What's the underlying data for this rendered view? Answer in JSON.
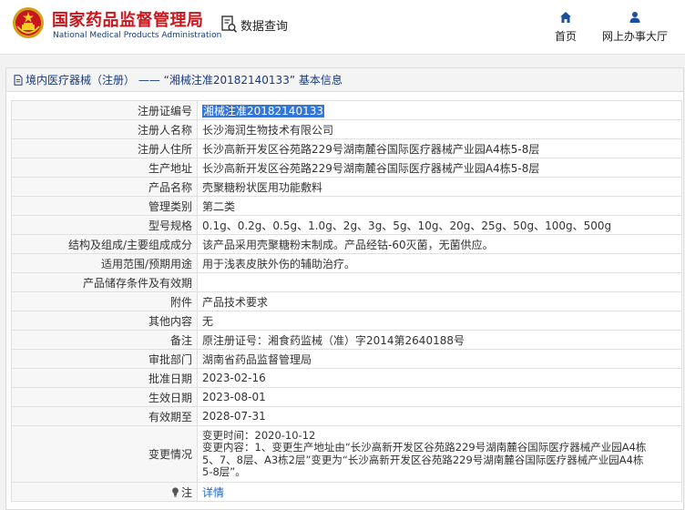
{
  "header": {
    "title": "国家药品监督管理局",
    "subtitle": "National Medical Products Administration",
    "search_label": "数据查询",
    "nav": {
      "home_label": "首页",
      "service_label": "网上办事大厅"
    }
  },
  "panel": {
    "title": "境内医疗器械（注册） —— “湘械注准20182140133” 基本信息"
  },
  "rows": [
    {
      "key": "注册证编号",
      "value": "湘械注准20182140133"
    },
    {
      "key": "注册人名称",
      "value": "长沙海润生物技术有限公司"
    },
    {
      "key": "注册人住所",
      "value": "长沙高新开发区谷苑路229号湖南麓谷国际医疗器械产业园A4栋5-8层"
    },
    {
      "key": "生产地址",
      "value": "长沙高新开发区谷苑路229号湖南麓谷国际医疗器械产业园A4栋5-8层"
    },
    {
      "key": "产品名称",
      "value": "壳聚糖粉状医用功能敷料"
    },
    {
      "key": "管理类别",
      "value": "第二类"
    },
    {
      "key": "型号规格",
      "value": "0.1g、0.2g、0.5g、1.0g、2g、3g、5g、10g、20g、25g、50g、100g、500g"
    },
    {
      "key": "结构及组成/主要组成成分",
      "value": "该产品采用壳聚糖粉末制成。产品经钴-60灭菌，无菌供应。"
    },
    {
      "key": "适用范围/预期用途",
      "value": "用于浅表皮肤外伤的辅助治疗。"
    },
    {
      "key": "产品储存条件及有效期",
      "value": ""
    },
    {
      "key": "附件",
      "value": "产品技术要求"
    },
    {
      "key": "其他内容",
      "value": "无"
    },
    {
      "key": "备注",
      "value": "原注册证号：湘食药监械（准）字2014第2640188号"
    },
    {
      "key": "审批部门",
      "value": "湖南省药品监督管理局"
    },
    {
      "key": "批准日期",
      "value": "2023-02-16"
    },
    {
      "key": "生效日期",
      "value": "2023-08-01"
    },
    {
      "key": "有效期至",
      "value": "2028-07-31"
    }
  ],
  "change": {
    "key": "变更情况",
    "line1": "变更时间：2020-10-12",
    "line2": "变更内容：1、变更生产地址由“长沙高新开发区谷苑路229号湖南麓谷国际医疗器械产业园A4栋",
    "line3": "5、7、8层、A3栋2层”变更为“长沙高新开发区谷苑路229号湖南麓谷国际医疗器械产业园A4栋",
    "line4": "5-8层”。"
  },
  "note": {
    "key": "注",
    "link_label": "详情"
  },
  "colors": {
    "brand_red": "#c8161d",
    "brand_blue": "#1a3a7a",
    "selection": "#3376d8",
    "link": "#1a66cc"
  }
}
